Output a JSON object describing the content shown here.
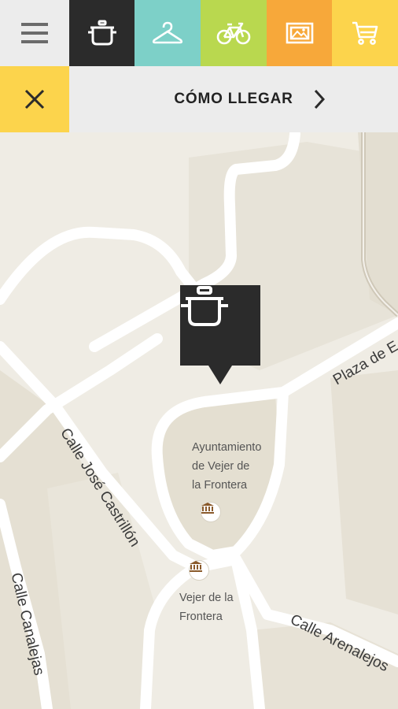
{
  "toolbar": {
    "tabs": [
      {
        "name": "menu",
        "icon": "hamburger-icon",
        "color": "#ececec"
      },
      {
        "name": "food",
        "icon": "cooking-pot-icon",
        "color": "#2b2b2b"
      },
      {
        "name": "fashion",
        "icon": "clothes-hanger-icon",
        "color": "#7dd0c8"
      },
      {
        "name": "bike",
        "icon": "bicycle-icon",
        "color": "#b9d84f"
      },
      {
        "name": "gallery",
        "icon": "picture-icon",
        "color": "#f7a83a"
      },
      {
        "name": "cart",
        "icon": "shopping-cart-icon",
        "color": "#fcd44c"
      }
    ]
  },
  "actionbar": {
    "close_icon": "close-icon",
    "directions_label": "CÓMO LLEGAR",
    "chevron_icon": "chevron-right-icon"
  },
  "map": {
    "marker_icon": "cooking-pot-icon",
    "streets": {
      "plaza": "Plaza de E",
      "castrillon": "Calle José Castrillón",
      "canalejas": "Calle Canalejas",
      "arenalejos": "Calle Arenalejos"
    },
    "pois": {
      "ayuntamiento_line1": "Ayuntamiento",
      "ayuntamiento_line2": "de Vejer de",
      "ayuntamiento_line3": "la Frontera",
      "vejer_line1": "Vejer de la",
      "vejer_line2": "Frontera"
    }
  }
}
